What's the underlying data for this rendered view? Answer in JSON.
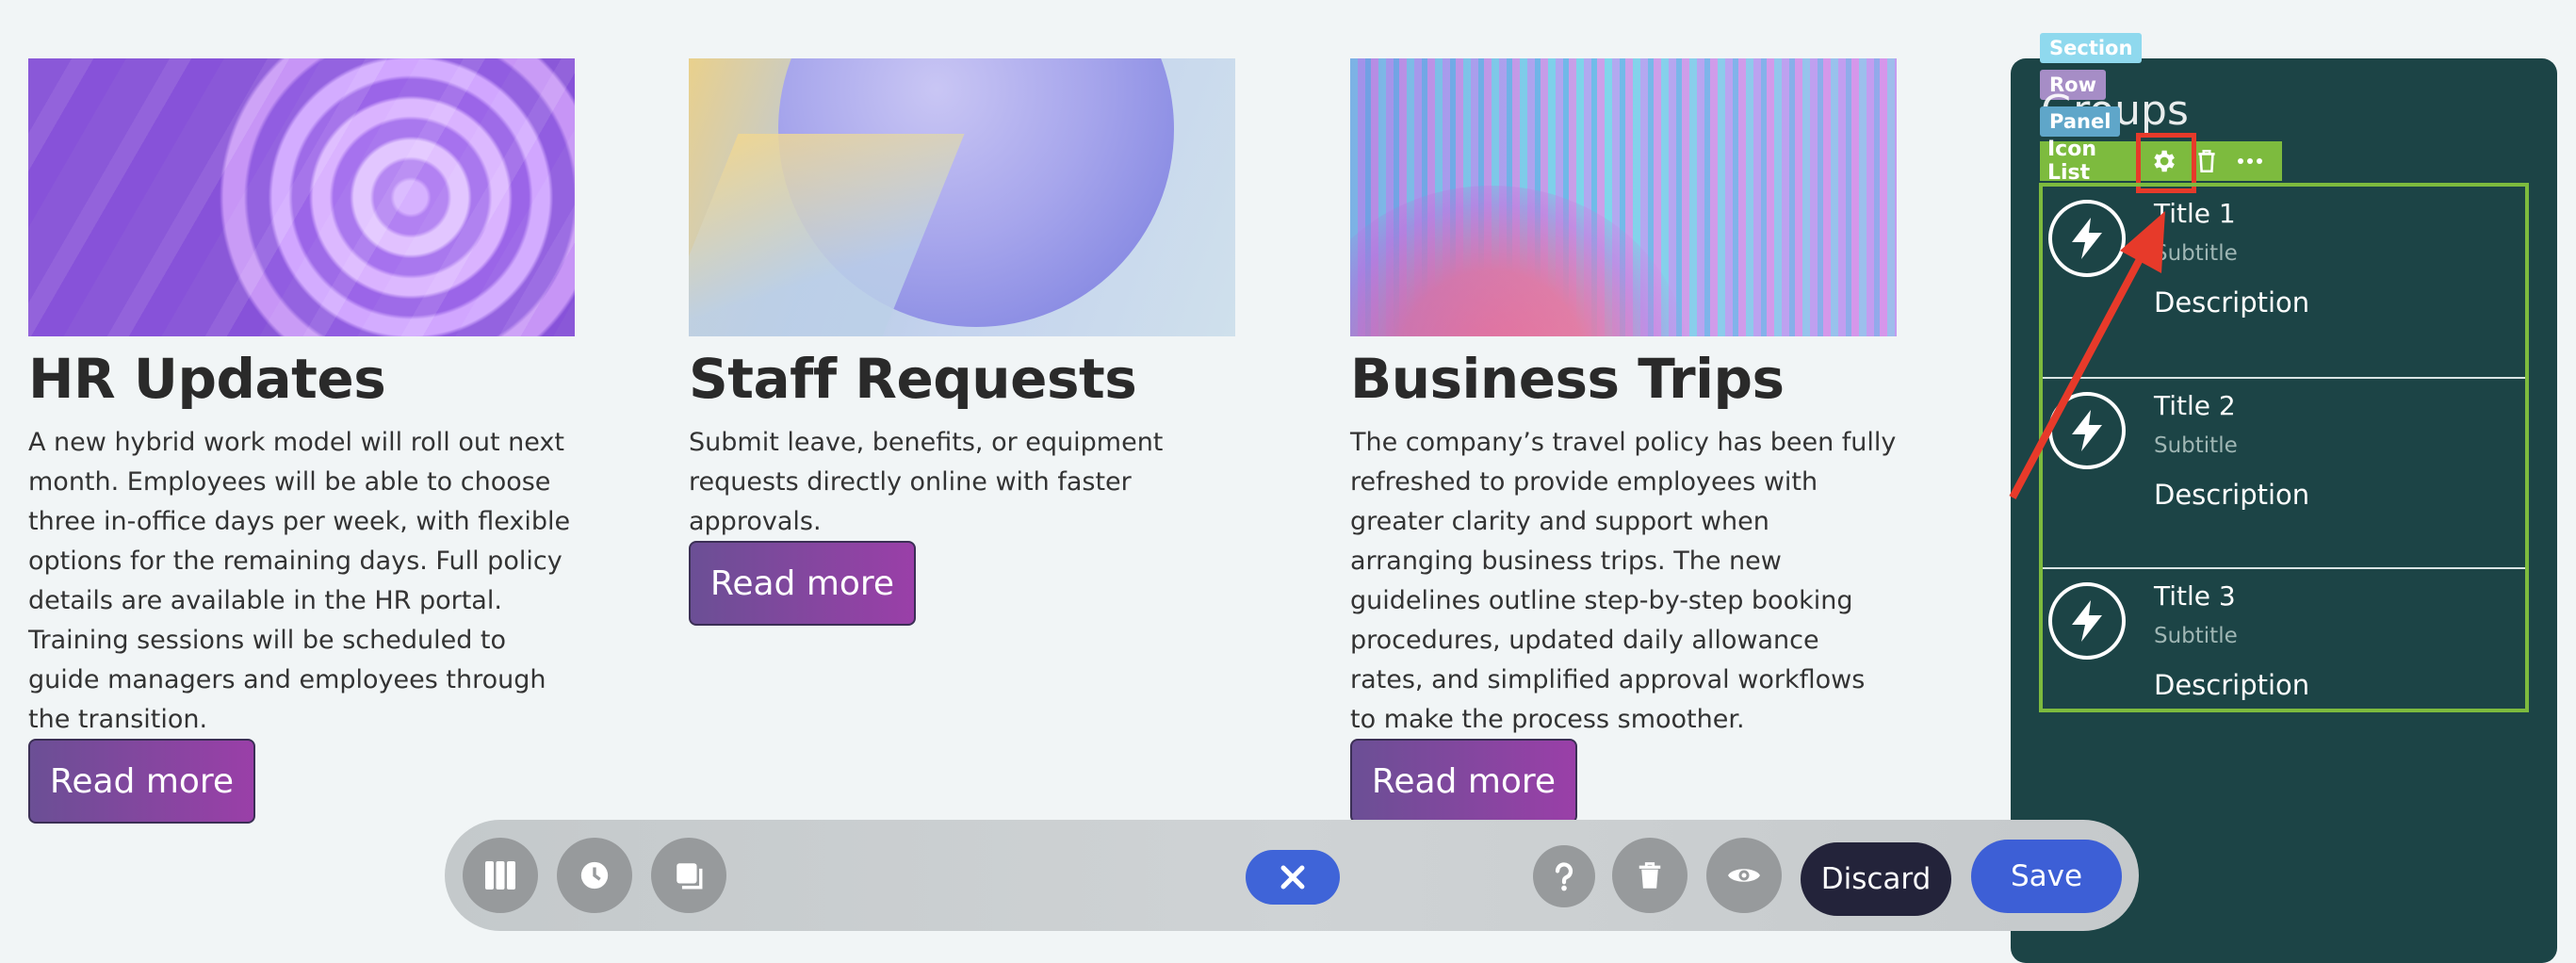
{
  "cards": [
    {
      "title": "HR Updates",
      "text": "A new hybrid work model will roll out next month. Employees will be able to choose three in-office days per week, with flexible options for the remaining days. Full policy details are available in the HR portal. Training sessions will be scheduled to guide managers and employees through the transition.",
      "button": "Read more"
    },
    {
      "title": "Staff Requests",
      "text": "Submit leave, benefits, or equipment requests directly online with faster approvals.",
      "button": "Read more"
    },
    {
      "title": "Business Trips",
      "text": "The company’s travel policy has been fully refreshed to provide employees with greater clarity and support when arranging business trips. The new guidelines outline step-by-step booking procedures, updated daily allowance rates, and simplified approval workflows to make the process smoother.",
      "button": "Read more"
    }
  ],
  "editor": {
    "tags": {
      "section": "Section",
      "row": "Row",
      "panel": "Panel",
      "icon_list": "Icon List"
    },
    "panel_title": "Groups",
    "items": [
      {
        "title": "Title 1",
        "subtitle": "Subtitle",
        "description": "Description",
        "icon": "lightning-icon"
      },
      {
        "title": "Title 2",
        "subtitle": "Subtitle",
        "description": "Description",
        "icon": "lightning-icon"
      },
      {
        "title": "Title 3",
        "subtitle": "Subtitle",
        "description": "Description",
        "icon": "lightning-icon"
      }
    ]
  },
  "toolbar": {
    "discard_label": "Discard",
    "save_label": "Save",
    "left_icons": [
      "columns-icon",
      "history-icon",
      "layers-icon"
    ],
    "right_icons": [
      "help-icon",
      "trash-icon",
      "preview-icon"
    ]
  },
  "colors": {
    "button_gradient_start": "#6b4f95",
    "button_gradient_end": "#9a3fa8",
    "panel_bg": "#1c4446",
    "selection_green": "#7dbb3e",
    "highlight_red": "#e73a2a",
    "save_blue": "#3d5fd6",
    "discard_dark": "#23233a"
  }
}
